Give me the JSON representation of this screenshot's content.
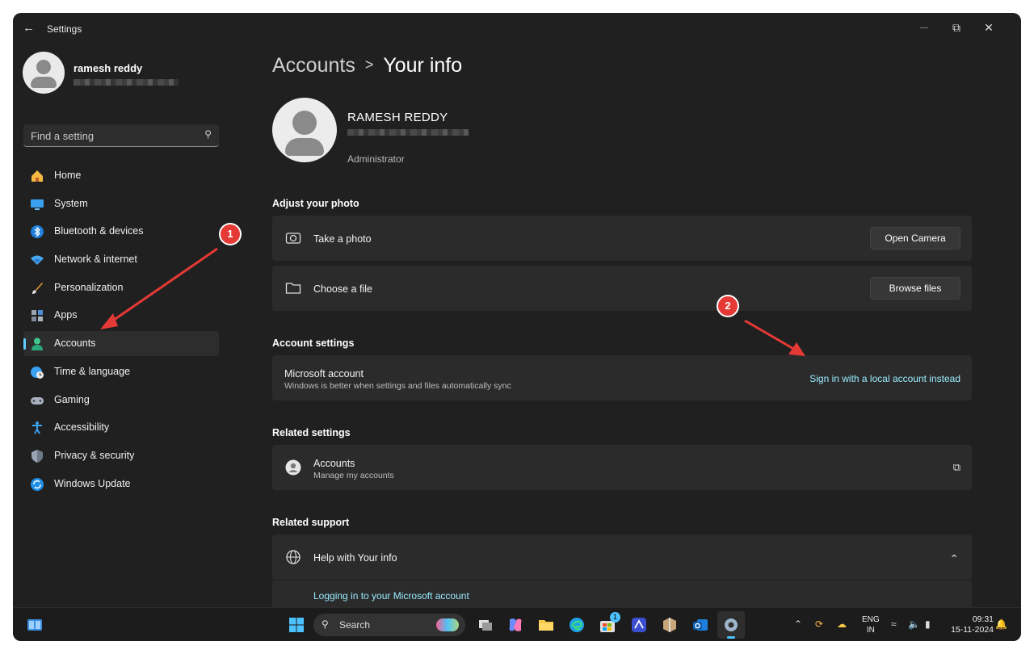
{
  "window": {
    "title": "Settings",
    "back_glyph": "←",
    "minimize_glyph": "—",
    "restore_glyph": "⧉",
    "close_glyph": "✕"
  },
  "profile": {
    "name": "ramesh reddy"
  },
  "search": {
    "placeholder": "Find a setting",
    "icon": "search-icon"
  },
  "nav": {
    "items": [
      {
        "label": "Home",
        "icon": "home-icon"
      },
      {
        "label": "System",
        "icon": "system-icon"
      },
      {
        "label": "Bluetooth & devices",
        "icon": "bluetooth-icon"
      },
      {
        "label": "Network & internet",
        "icon": "wifi-icon"
      },
      {
        "label": "Personalization",
        "icon": "brush-icon"
      },
      {
        "label": "Apps",
        "icon": "apps-icon"
      },
      {
        "label": "Accounts",
        "icon": "accounts-icon",
        "active": true
      },
      {
        "label": "Time & language",
        "icon": "globe-clock-icon"
      },
      {
        "label": "Gaming",
        "icon": "gamepad-icon"
      },
      {
        "label": "Accessibility",
        "icon": "accessibility-icon"
      },
      {
        "label": "Privacy & security",
        "icon": "shield-icon"
      },
      {
        "label": "Windows Update",
        "icon": "update-icon"
      }
    ]
  },
  "breadcrumb": {
    "parent": "Accounts",
    "separator": ">",
    "current": "Your info"
  },
  "user": {
    "display_name": "RAMESH REDDY",
    "role": "Administrator"
  },
  "photo": {
    "section_title": "Adjust your photo",
    "take_photo": {
      "label": "Take a photo",
      "button": "Open Camera"
    },
    "choose_file": {
      "label": "Choose a file",
      "button": "Browse files"
    }
  },
  "account_settings": {
    "section_title": "Account settings",
    "title": "Microsoft account",
    "subtitle": "Windows is better when settings and files automatically sync",
    "link": "Sign in with a local account instead"
  },
  "related_settings": {
    "section_title": "Related settings",
    "title": "Accounts",
    "subtitle": "Manage my accounts",
    "external_glyph": "⧉"
  },
  "related_support": {
    "section_title": "Related support",
    "title": "Help with Your info",
    "link": "Logging in to your Microsoft account",
    "chevron_glyph": "⌃"
  },
  "annotations": {
    "one": "1",
    "two": "2",
    "color": "#e53935"
  },
  "taskbar": {
    "search_label": "Search",
    "store_badge": "1",
    "lang_line1": "ENG",
    "lang_line2": "IN",
    "time": "09:31",
    "date": "15-11-2024"
  },
  "colors": {
    "accent": "#60cdff",
    "link": "#99ebff",
    "background": "#202020",
    "card": "#2b2b2b"
  }
}
